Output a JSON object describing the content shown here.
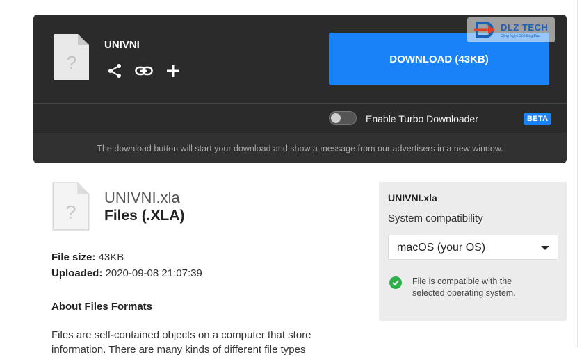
{
  "download_card": {
    "file_name": "UNIVNI",
    "download_label": "DOWNLOAD (43KB)",
    "actions": [
      "share-icon",
      "link-icon",
      "plus-icon"
    ],
    "turbo_label": "Enable Turbo Downloader",
    "turbo_enabled": false,
    "beta_badge": "BETA",
    "notice": "The download button will start your download and show a message from our advertisers in a new window."
  },
  "watermark": {
    "title": "DLZ TECH",
    "subtitle": "Công Nghệ Số Hàng Đầu"
  },
  "file_info": {
    "filename": "UNIVNI.xla",
    "type_label": "Files (.XLA)",
    "size_label": "File size:",
    "size_value": "43KB",
    "uploaded_label": "Uploaded:",
    "uploaded_value": "2020-09-08 21:07:39",
    "about_title": "About Files Formats",
    "about_text": "Files are self-contained objects on a computer that store information. There are many kinds of different file types"
  },
  "compatibility": {
    "title": "UNIVNI.xla",
    "subtitle": "System compatibility",
    "selected_os": "macOS (your OS)",
    "status_text": "File is compatible with the selected operating system."
  },
  "colors": {
    "accent": "#1a82f7",
    "dark_bg": "#2b2b2b",
    "ok_green": "#2db24b"
  }
}
